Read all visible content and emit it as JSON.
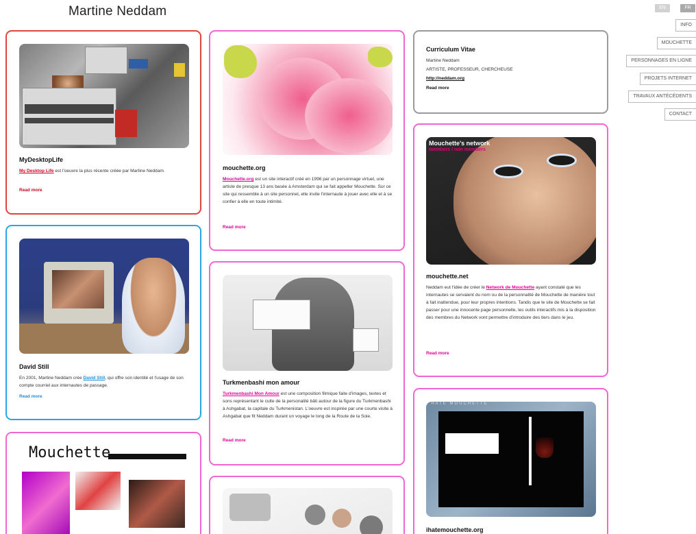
{
  "site": {
    "title": "Martine Neddam"
  },
  "lang": {
    "en": "EN",
    "fr": "FR"
  },
  "nav": [
    "INFO",
    "MOUCHETTE",
    "PERSONNAGES EN LIGNE",
    "PROJETS INTERNET",
    "TRAVAUX ANTÉCÉDENTS",
    "CONTACT"
  ],
  "colors": {
    "red": "#e0443b",
    "blue": "#2aa5e6",
    "pink": "#f065d4",
    "grey": "#9a9a9a",
    "link_red": "#d4001b",
    "link_blue": "#1b8fdc",
    "link_pink": "#e2009a"
  },
  "cards": {
    "mydesktop": {
      "title": "MyDesktopLife",
      "link": "My Desktop Life",
      "desc": " est l'oeuvre la plus récente créée par Martine Neddam.",
      "more": "Read more"
    },
    "david": {
      "title": "David Still",
      "desc_a": "En 2001, Martine Neddam crée ",
      "link": "David Still",
      "desc_b": ", qui offre son identité et l'usage de son compte courriel aux internautes de passage.",
      "more": "Read more"
    },
    "mouchette_org": {
      "title": "mouchette.org",
      "link": "Mouchette.org",
      "desc": " est un site interactif créé en 1996 par un personnage virtuel, une artiste de presque 13 ans basée à Amsterdam qui se fait appeller Mouchette. Sur ce site qui ressemble à un site personnel, elle invite l'internaute à jouer avec elle et à se confier à elle en toute intimité.",
      "more": "Read more"
    },
    "turkmenbashi": {
      "title": "Turkmenbashi mon amour",
      "link": "Turkmenbashi Mon Amour",
      "desc": " est une composition filmique faite d'images, textes et sons représentant le culte de la personalité bâti autour de la figure du Turkmenbashi à Ashgabat, la capitale du Turkmenistan. L'oeuvre est inspirée par une courte visite à Ashgabat que fit Neddam durant un voyage le long de la Route de la Soie.",
      "more": "Read more"
    },
    "cv": {
      "title": "Curriculum Vitae",
      "line1": "Martine Neddam",
      "line2": "ARTISTE, PROFESSEUR, CHERCHEUSE",
      "link": "http://neddam.org",
      "more": "Read more"
    },
    "mouchette_net": {
      "title": "mouchette.net",
      "desc_a": "Neddam eut l'idée de créer le ",
      "link": "Network de Mouchette",
      "desc_b": " ayant constaté que les internautes se servaient du nom ou de la personnalité de Mouchette de manière tout à fait inattendue, pour leur propres intentions. Tandis que le site de Mouchette se fait passer pour une innocente page personnelle, les outils interactifs mis à la disposition des membres du Network vont permettre d'introduire des tiers dans le jeu.",
      "more": "Read more"
    },
    "ihate": {
      "title": "ihatemouchette.org"
    }
  },
  "thumbs": {
    "mouchette_logo": "Mouchette",
    "network_heading": "Mouchette's network",
    "network_sub": "members / non members",
    "ihate_heading": "I HATE MOUCHETTE"
  }
}
